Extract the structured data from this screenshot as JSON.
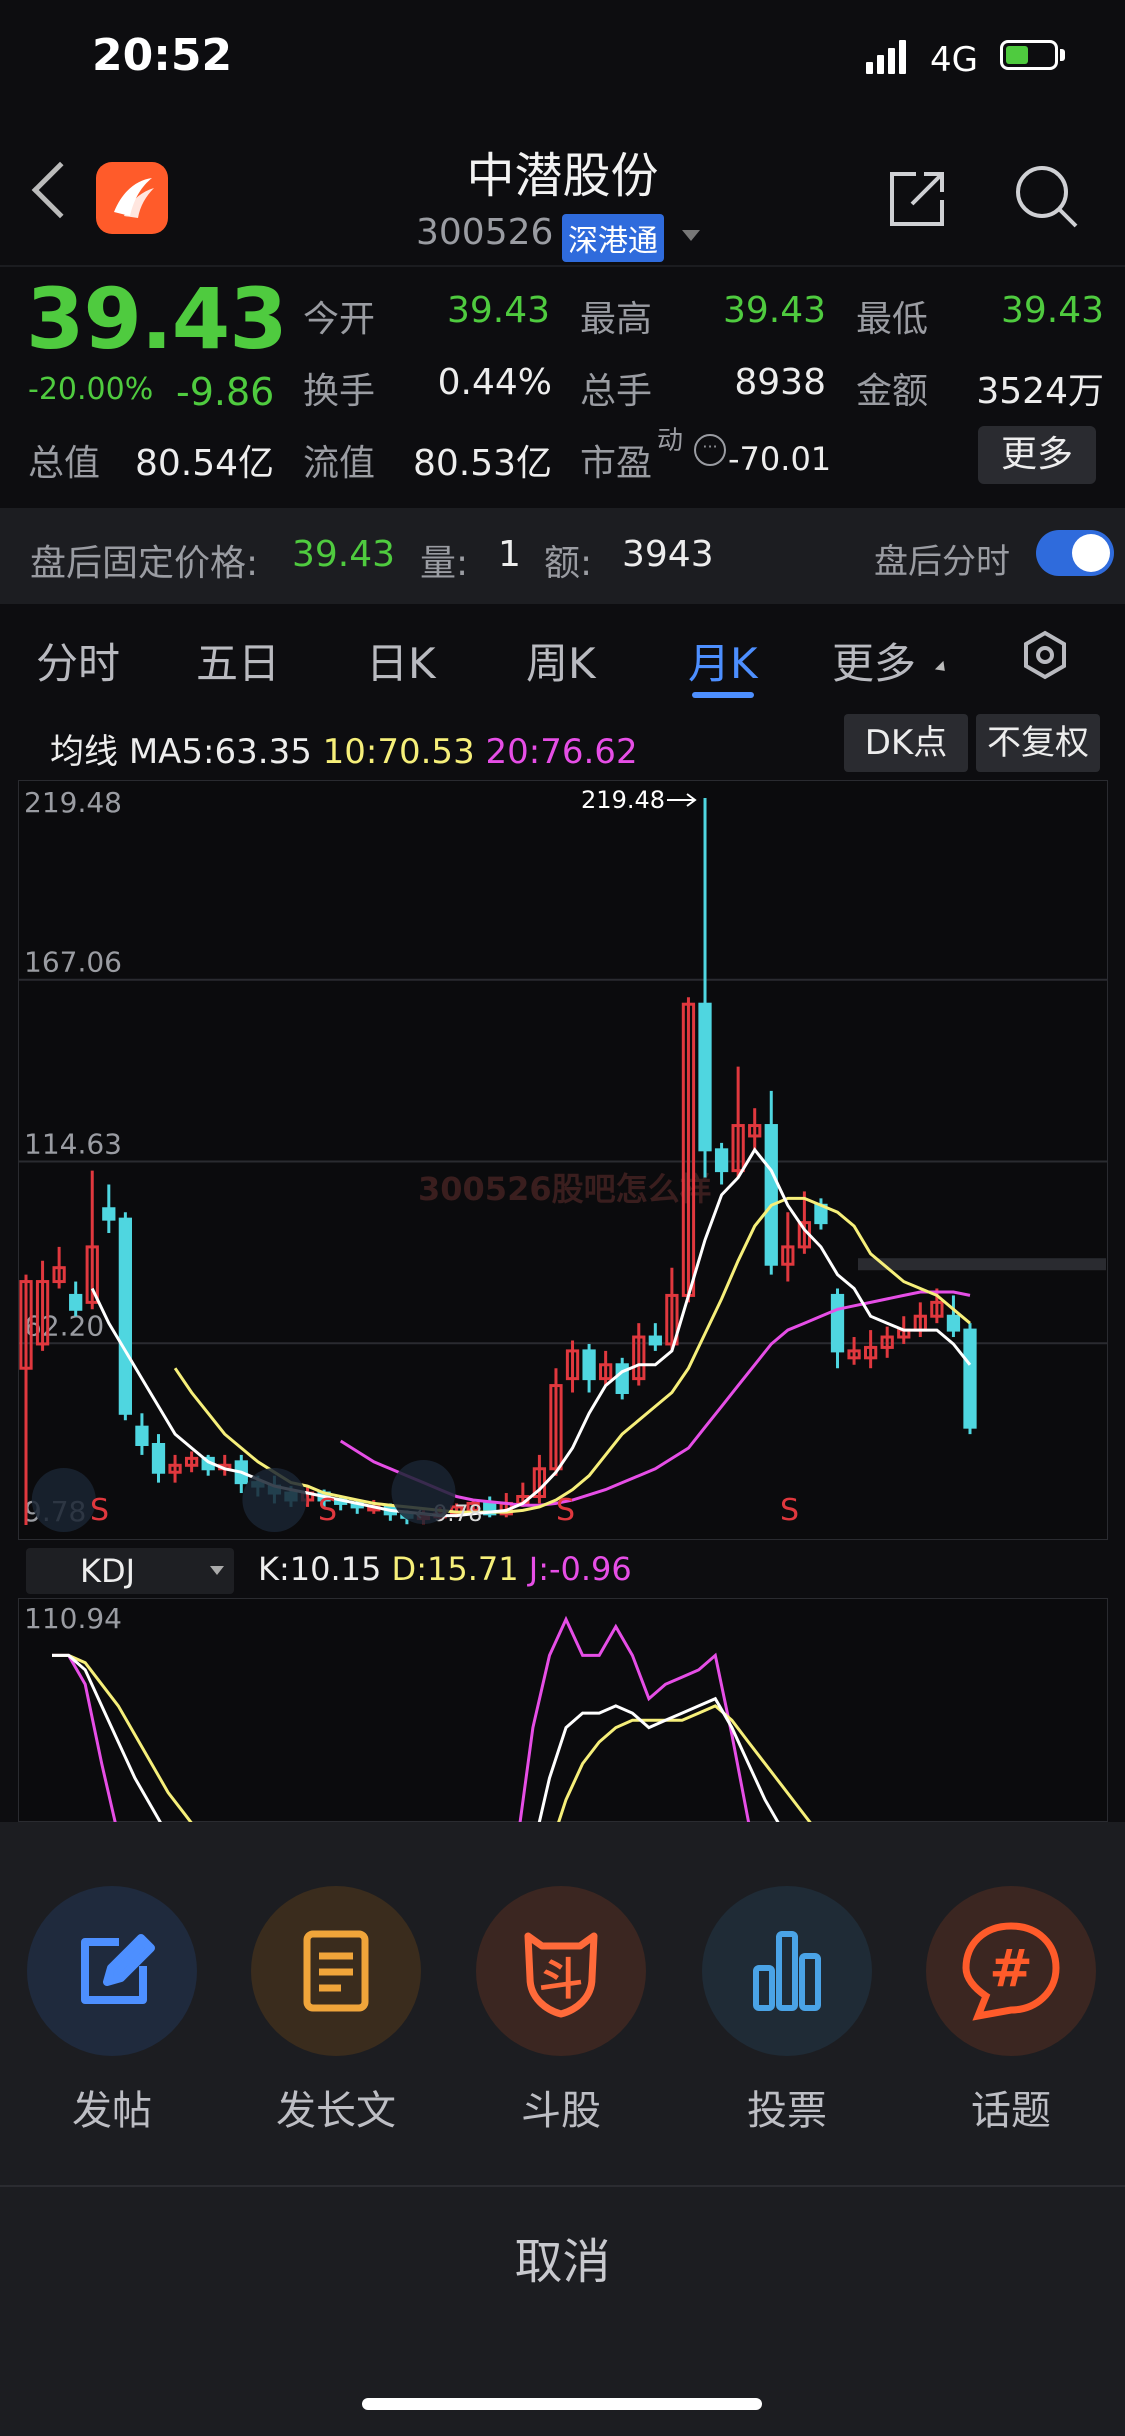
{
  "status": {
    "time": "20:52",
    "network": "4G"
  },
  "header": {
    "stock_name": "中潜股份",
    "stock_code": "300526",
    "connect_badge": "深港通"
  },
  "quote": {
    "price": "39.43",
    "change_pct": "-20.00%",
    "change": "-9.86",
    "open_label": "今开",
    "open": "39.43",
    "high_label": "最高",
    "high": "39.43",
    "low_label": "最低",
    "low": "39.43",
    "turnover_label": "换手",
    "turnover": "0.44%",
    "volume_label": "总手",
    "volume": "8938",
    "amount_label": "金额",
    "amount": "3524万",
    "mktcap_label": "总值",
    "mktcap": "80.54亿",
    "float_label": "流值",
    "float_cap": "80.53亿",
    "pe_label": "市盈",
    "pe_sup": "动",
    "pe": "-70.01",
    "more_label": "更多"
  },
  "after_hours": {
    "label": "盘后固定价格:",
    "price": "39.43",
    "vol_label": "量:",
    "vol": "1",
    "amt_label": "额:",
    "amt": "3943",
    "timeshare_label": "盘后分时",
    "toggle_on": true
  },
  "tabs": [
    {
      "label": "分时"
    },
    {
      "label": "五日"
    },
    {
      "label": "日K"
    },
    {
      "label": "周K"
    },
    {
      "label": "月K",
      "active": true
    },
    {
      "label": "更多"
    }
  ],
  "ma": {
    "title": "均线",
    "ma5": "MA5:63.35",
    "ma10": "10:70.53",
    "ma20": "20:76.62",
    "dk_label": "DK点",
    "fq_label": "不复权"
  },
  "chart_data": {
    "type": "candlestick",
    "y_ticks": [
      "219.48",
      "167.06",
      "114.63",
      "62.20",
      "9.78"
    ],
    "ylim": [
      9.78,
      219.48
    ],
    "annotations": {
      "max": "219.48",
      "min": "9.78",
      "signal": "S"
    },
    "watermark": "300526股吧怎么样",
    "candles": [
      {
        "o": 80,
        "c": 55,
        "h": 82,
        "l": 9.78,
        "rise": true
      },
      {
        "o": 62,
        "c": 80,
        "h": 86,
        "l": 60,
        "rise": true
      },
      {
        "o": 80,
        "c": 84,
        "h": 90,
        "l": 78,
        "rise": true
      },
      {
        "o": 72,
        "c": 76,
        "h": 80,
        "l": 70,
        "rise": false
      },
      {
        "o": 74,
        "c": 90,
        "h": 112,
        "l": 72,
        "rise": true
      },
      {
        "o": 101,
        "c": 98,
        "h": 108,
        "l": 94,
        "rise": false
      },
      {
        "o": 98,
        "c": 42,
        "h": 100,
        "l": 40,
        "rise": false
      },
      {
        "o": 38,
        "c": 33,
        "h": 42,
        "l": 30,
        "rise": false
      },
      {
        "o": 33,
        "c": 25,
        "h": 36,
        "l": 22,
        "rise": false
      },
      {
        "o": 25,
        "c": 27,
        "h": 30,
        "l": 22,
        "rise": true
      },
      {
        "o": 27,
        "c": 29,
        "h": 31,
        "l": 25,
        "rise": true
      },
      {
        "o": 29,
        "c": 26,
        "h": 30,
        "l": 24,
        "rise": false
      },
      {
        "o": 26,
        "c": 27,
        "h": 30,
        "l": 24,
        "rise": true
      },
      {
        "o": 28,
        "c": 22,
        "h": 30,
        "l": 19,
        "rise": false
      },
      {
        "o": 22,
        "c": 21,
        "h": 24,
        "l": 18,
        "rise": false
      },
      {
        "o": 21,
        "c": 19,
        "h": 24,
        "l": 16,
        "rise": false
      },
      {
        "o": 19,
        "c": 17,
        "h": 21,
        "l": 15,
        "rise": false
      },
      {
        "o": 17,
        "c": 19,
        "h": 21,
        "l": 15,
        "rise": true
      },
      {
        "o": 19,
        "c": 17,
        "h": 20,
        "l": 15,
        "rise": false
      },
      {
        "o": 17,
        "c": 16,
        "h": 18,
        "l": 14,
        "rise": false
      },
      {
        "o": 16,
        "c": 15,
        "h": 17,
        "l": 13,
        "rise": false
      },
      {
        "o": 15,
        "c": 15,
        "h": 17,
        "l": 13,
        "rise": true
      },
      {
        "o": 15,
        "c": 13,
        "h": 16,
        "l": 11,
        "rise": false
      },
      {
        "o": 13,
        "c": 12,
        "h": 14,
        "l": 10,
        "rise": false
      },
      {
        "o": 12,
        "c": 12.5,
        "h": 14,
        "l": 10,
        "rise": true
      },
      {
        "o": 12.5,
        "c": 13,
        "h": 15,
        "l": 11,
        "rise": true
      },
      {
        "o": 13,
        "c": 15,
        "h": 16,
        "l": 12,
        "rise": true
      },
      {
        "o": 14,
        "c": 16,
        "h": 17,
        "l": 13,
        "rise": true
      },
      {
        "o": 16,
        "c": 13,
        "h": 18,
        "l": 12,
        "rise": false
      },
      {
        "o": 13,
        "c": 16,
        "h": 19,
        "l": 12,
        "rise": true
      },
      {
        "o": 16,
        "c": 18,
        "h": 22,
        "l": 15,
        "rise": true
      },
      {
        "o": 18,
        "c": 26,
        "h": 30,
        "l": 16,
        "rise": true
      },
      {
        "o": 26,
        "c": 50,
        "h": 55,
        "l": 24,
        "rise": true
      },
      {
        "o": 52,
        "c": 60,
        "h": 63,
        "l": 48,
        "rise": true
      },
      {
        "o": 60,
        "c": 52,
        "h": 62,
        "l": 48,
        "rise": false
      },
      {
        "o": 52,
        "c": 56,
        "h": 60,
        "l": 50,
        "rise": true
      },
      {
        "o": 56,
        "c": 48,
        "h": 58,
        "l": 46,
        "rise": false
      },
      {
        "o": 52,
        "c": 64,
        "h": 68,
        "l": 50,
        "rise": true
      },
      {
        "o": 64,
        "c": 62,
        "h": 68,
        "l": 60,
        "rise": false
      },
      {
        "o": 62,
        "c": 76,
        "h": 84,
        "l": 60,
        "rise": true
      },
      {
        "o": 76,
        "c": 160,
        "h": 162,
        "l": 74,
        "rise": true
      },
      {
        "o": 160,
        "c": 118,
        "h": 219.48,
        "l": 110,
        "rise": false
      },
      {
        "o": 118,
        "c": 112,
        "h": 120,
        "l": 108,
        "rise": false
      },
      {
        "o": 112,
        "c": 125,
        "h": 142,
        "l": 110,
        "rise": true
      },
      {
        "o": 125,
        "c": 122,
        "h": 130,
        "l": 118,
        "rise": true
      },
      {
        "o": 125,
        "c": 85,
        "h": 135,
        "l": 82,
        "rise": false
      },
      {
        "o": 85,
        "c": 90,
        "h": 100,
        "l": 80,
        "rise": true
      },
      {
        "o": 90,
        "c": 97,
        "h": 106,
        "l": 88,
        "rise": true
      },
      {
        "o": 97,
        "c": 102,
        "h": 104,
        "l": 95,
        "rise": false
      },
      {
        "o": 76,
        "c": 60,
        "h": 78,
        "l": 55,
        "rise": false
      },
      {
        "o": 60,
        "c": 58,
        "h": 64,
        "l": 56,
        "rise": true
      },
      {
        "o": 58,
        "c": 61,
        "h": 66,
        "l": 55,
        "rise": true
      },
      {
        "o": 61,
        "c": 64,
        "h": 67,
        "l": 58,
        "rise": true
      },
      {
        "o": 64,
        "c": 66,
        "h": 70,
        "l": 62,
        "rise": true
      },
      {
        "o": 66,
        "c": 70,
        "h": 74,
        "l": 64,
        "rise": true
      },
      {
        "o": 70,
        "c": 74,
        "h": 78,
        "l": 68,
        "rise": true
      },
      {
        "o": 70,
        "c": 66,
        "h": 76,
        "l": 64,
        "rise": false
      },
      {
        "o": 66,
        "c": 38,
        "h": 68,
        "l": 36,
        "rise": false
      }
    ],
    "ma5": [
      null,
      null,
      null,
      null,
      78,
      68,
      60,
      52,
      44,
      36,
      32,
      28,
      26,
      25,
      23,
      21,
      20,
      19,
      18,
      17,
      16,
      15,
      14,
      13.5,
      13,
      12.5,
      12.5,
      13,
      13.5,
      14,
      16,
      20,
      25,
      32,
      42,
      50,
      54,
      56,
      56,
      60,
      76,
      92,
      105,
      110,
      118,
      112,
      102,
      95,
      90,
      82,
      78,
      70,
      68,
      66,
      66,
      66,
      62,
      56
    ],
    "ma10": [
      null,
      null,
      null,
      null,
      null,
      null,
      null,
      null,
      null,
      55,
      48,
      42,
      36,
      32,
      28,
      25,
      22,
      21,
      19,
      18,
      17,
      16,
      15.5,
      15,
      14.5,
      14,
      13.5,
      13.5,
      13.5,
      13.5,
      14,
      15,
      17,
      20,
      24,
      30,
      36,
      40,
      44,
      48,
      55,
      65,
      75,
      86,
      96,
      102,
      104,
      104,
      102,
      100,
      96,
      88,
      84,
      80,
      78,
      76,
      72,
      68
    ],
    "ma20": [
      null,
      null,
      null,
      null,
      null,
      null,
      null,
      null,
      null,
      null,
      null,
      null,
      null,
      null,
      null,
      null,
      null,
      null,
      null,
      34,
      31,
      28,
      26,
      24,
      22,
      20,
      18,
      17,
      16.5,
      16,
      15.5,
      15.5,
      16,
      17,
      18.5,
      20,
      22,
      24,
      26,
      29,
      32,
      38,
      44,
      50,
      56,
      62,
      66,
      68,
      70,
      72,
      73,
      74,
      75,
      76,
      77,
      77,
      77,
      76
    ]
  },
  "kdj": {
    "name": "KDJ",
    "k": "K:10.15",
    "d": "D:15.71",
    "j": "J:-0.96",
    "y_top": "110.94",
    "k_series": [
      100,
      100,
      96,
      86,
      76,
      66,
      58,
      50,
      44,
      38,
      32,
      28,
      24,
      20,
      16,
      12,
      10,
      12,
      14,
      16,
      14,
      14,
      14,
      14,
      14,
      14,
      14,
      18,
      28,
      46,
      66,
      80,
      84,
      84,
      86,
      84,
      80,
      82,
      84,
      86,
      88,
      80,
      70,
      60,
      52,
      44,
      36,
      30,
      24,
      20,
      16,
      14,
      12,
      12,
      12,
      10
    ],
    "d_series": [
      100,
      100,
      98,
      92,
      86,
      78,
      70,
      62,
      56,
      50,
      44,
      40,
      36,
      32,
      28,
      24,
      20,
      18,
      18,
      18,
      16,
      16,
      16,
      16,
      16,
      16,
      16,
      18,
      22,
      32,
      46,
      60,
      70,
      76,
      80,
      82,
      82,
      82,
      82,
      84,
      86,
      82,
      76,
      70,
      64,
      58,
      52,
      46,
      40,
      34,
      28,
      24,
      22,
      20,
      18,
      15.71
    ],
    "j_series": [
      100,
      100,
      92,
      70,
      50,
      30,
      15,
      0,
      0,
      0,
      0,
      0,
      0,
      0,
      0,
      0,
      0,
      8,
      14,
      16,
      10,
      8,
      8,
      8,
      8,
      8,
      8,
      18,
      46,
      80,
      100,
      110,
      100,
      100,
      108,
      100,
      88,
      92,
      94,
      96,
      100,
      78,
      54,
      38,
      28,
      18,
      8,
      4,
      0,
      0,
      0,
      0,
      0,
      0,
      0,
      0
    ]
  },
  "actions": [
    {
      "label": "发帖",
      "icon": "edit-icon",
      "bg": "#1f2a3d",
      "color": "#4d8fff"
    },
    {
      "label": "发长文",
      "icon": "document-icon",
      "bg": "#3a2c1d",
      "color": "#f0a53a"
    },
    {
      "label": "斗股",
      "icon": "fight-icon",
      "bg": "#3b2621",
      "color": "#ff6a3a"
    },
    {
      "label": "投票",
      "icon": "vote-icon",
      "bg": "#1f2b36",
      "color": "#4aa3e6"
    },
    {
      "label": "话题",
      "icon": "topic-icon",
      "bg": "#3b2621",
      "color": "#ff5b2a"
    }
  ],
  "cancel_label": "取消"
}
